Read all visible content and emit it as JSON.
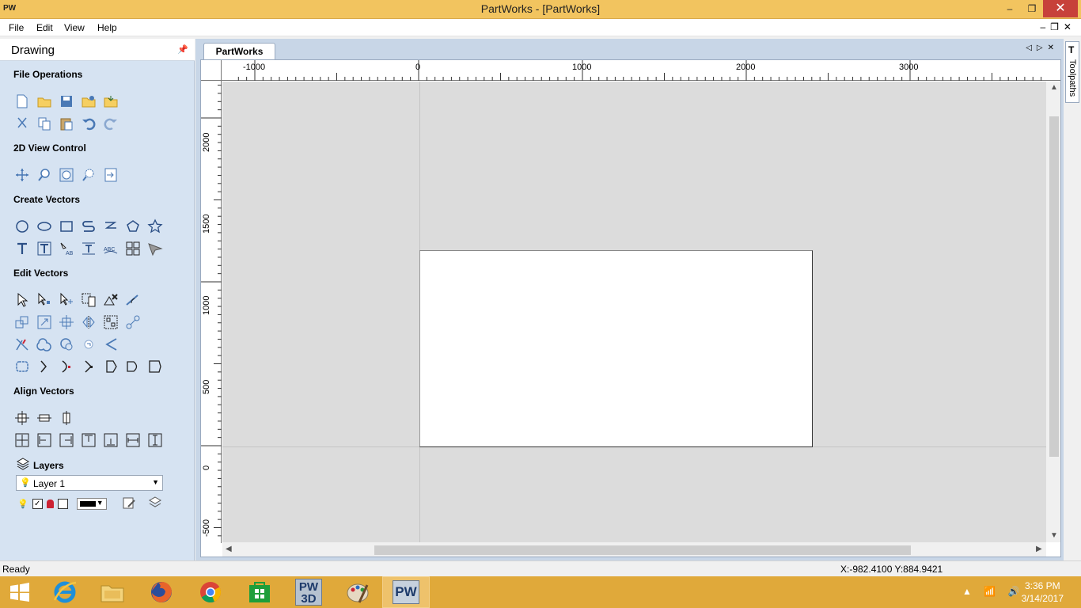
{
  "window": {
    "app_icon_text": "PW",
    "title": "PartWorks - [PartWorks]",
    "controls": {
      "minimize": "‒",
      "maximize": "❐",
      "close": "✕"
    }
  },
  "menu": [
    {
      "label": "File",
      "underline": "F"
    },
    {
      "label": "Edit",
      "underline": "E"
    },
    {
      "label": "View",
      "underline": "V"
    },
    {
      "label": "Help",
      "underline": "H"
    }
  ],
  "panel": {
    "title": "Drawing",
    "sections": {
      "file_operations": "File Operations",
      "view_control": "2D View Control",
      "create_vectors": "Create Vectors",
      "edit_vectors": "Edit Vectors",
      "align_vectors": "Align Vectors",
      "layers": "Layers"
    },
    "layer": {
      "selected": "Layer 1",
      "color": "#000000"
    }
  },
  "document": {
    "tab_label": "PartWorks",
    "side_tab_label": "Toolpaths",
    "h_ruler_labels": [
      "-1000",
      "0",
      "1000",
      "2000",
      "3000"
    ],
    "v_ruler_labels": [
      "2000",
      "1500",
      "1000",
      "500",
      "0",
      "-500"
    ]
  },
  "status": {
    "text": "Ready",
    "coordinates": "X:-982.4100 Y:884.9421"
  },
  "taskbar": {
    "apps": [
      "start",
      "internet-explorer",
      "file-explorer",
      "firefox",
      "chrome",
      "store",
      "pw3d",
      "paint",
      "partworks"
    ],
    "pw3d_label_top": "PW",
    "pw3d_label_bottom": "3D",
    "pw_label": "PW",
    "time": "3:36 PM",
    "date": "3/14/2017"
  },
  "colors": {
    "titlebar": "#f2c45f",
    "panel": "#d6e3f2",
    "taskbar": "#e0a93a",
    "close": "#c7413a"
  }
}
